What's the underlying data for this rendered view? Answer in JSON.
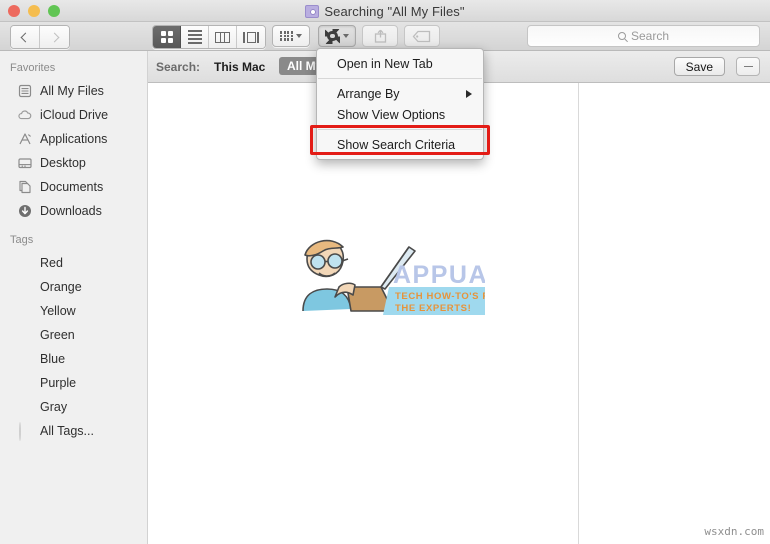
{
  "window": {
    "title": "Searching \"All My Files\"",
    "title_icon": "purple-search-folder-icon"
  },
  "toolbar": {
    "back_icon": "chevron-left-icon",
    "forward_icon": "chevron-right-icon",
    "view_icon_label": "icon-view",
    "view_list_label": "list-view",
    "view_column_label": "column-view",
    "view_coverflow_label": "coverflow-view",
    "arrange_label": "arrange-by",
    "action_label": "action-gear",
    "share_label": "share",
    "tag_label": "edit-tags"
  },
  "search": {
    "placeholder": "Search",
    "icon": "magnifier-icon"
  },
  "criteria_bar": {
    "label": "Search:",
    "scope_this_mac": "This Mac",
    "scope_selected": "All My Files",
    "save_label": "Save",
    "remove_icon": "minus-icon"
  },
  "sidebar": {
    "sections": [
      {
        "header": "Favorites",
        "items": [
          {
            "label": "All My Files",
            "icon": "all-my-files-icon"
          },
          {
            "label": "iCloud Drive",
            "icon": "icloud-icon"
          },
          {
            "label": "Applications",
            "icon": "applications-icon"
          },
          {
            "label": "Desktop",
            "icon": "desktop-icon"
          },
          {
            "label": "Documents",
            "icon": "documents-icon"
          },
          {
            "label": "Downloads",
            "icon": "downloads-icon"
          }
        ]
      },
      {
        "header": "Tags",
        "items": [
          {
            "label": "Red",
            "icon": "tag-dot-icon",
            "color": "#f6524c"
          },
          {
            "label": "Orange",
            "icon": "tag-dot-icon",
            "color": "#f5a623"
          },
          {
            "label": "Yellow",
            "icon": "tag-dot-icon",
            "color": "#f7cf3d"
          },
          {
            "label": "Green",
            "icon": "tag-dot-icon",
            "color": "#5cc64a"
          },
          {
            "label": "Blue",
            "icon": "tag-dot-icon",
            "color": "#43b9f0"
          },
          {
            "label": "Purple",
            "icon": "tag-dot-icon",
            "color": "#cf63dc"
          },
          {
            "label": "Gray",
            "icon": "tag-dot-icon",
            "color": "#8d8d8d"
          },
          {
            "label": "All Tags...",
            "icon": "all-tags-icon",
            "color": "#e4e4e4"
          }
        ]
      }
    ]
  },
  "menu": {
    "items": [
      {
        "label": "Open in New Tab",
        "submenu": false
      },
      {
        "label": "Arrange By",
        "submenu": true
      },
      {
        "label": "Show View Options",
        "submenu": false
      },
      {
        "label": "Show Search Criteria",
        "submenu": false
      }
    ],
    "highlight_color": "#e31c16",
    "highlighted_item": "Show Search Criteria"
  },
  "content": {
    "watermark_title": "APPUALS",
    "watermark_tagline_line1": "TECH HOW-TO'S FROM",
    "watermark_tagline_line2": "THE EXPERTS!",
    "site_mark": "wsxdn.com"
  }
}
